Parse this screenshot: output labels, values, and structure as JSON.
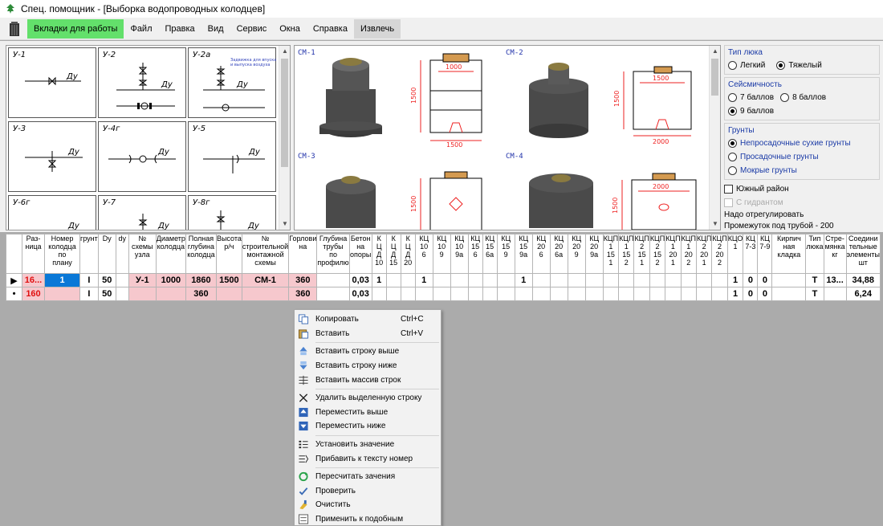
{
  "window": {
    "title": "Спец. помощник - [Выборка водопроводных колодцев]"
  },
  "menu": [
    "Вкладки для работы",
    "Файл",
    "Правка",
    "Вид",
    "Сервис",
    "Окна",
    "Справка",
    "Извлечь"
  ],
  "nodes": [
    {
      "label": "У-1",
      "dy": "Ду"
    },
    {
      "label": "У-2",
      "dy": "Ду"
    },
    {
      "label": "У-2а",
      "dy": "Ду"
    },
    {
      "label": "У-3",
      "dy": "Ду"
    },
    {
      "label": "У-4г",
      "dy": "Ду"
    },
    {
      "label": "У-5",
      "dy": "Ду"
    },
    {
      "label": "У-6г",
      "dy": "Ду"
    },
    {
      "label": "У-7",
      "dy": "Ду"
    },
    {
      "label": "У-8г",
      "dy": "Ду"
    }
  ],
  "schemes": [
    {
      "label": "СМ-1",
      "w": "1000",
      "h": "1500",
      "b": "1500"
    },
    {
      "label": "СМ-2",
      "w": "1500",
      "h": "1500",
      "b": "2000"
    },
    {
      "label": "СМ-3",
      "h": "1500"
    },
    {
      "label": "СМ-4",
      "w": "2000",
      "h": "1500"
    }
  ],
  "options": {
    "hatch_title": "Тип люка",
    "hatch": [
      {
        "label": "Легкий",
        "checked": false
      },
      {
        "label": "Тяжелый",
        "checked": true
      }
    ],
    "seismic_title": "Сейсмичность",
    "seismic": [
      {
        "label": "7 баллов",
        "checked": false
      },
      {
        "label": "8 баллов",
        "checked": false
      },
      {
        "label": "9 баллов",
        "checked": true
      }
    ],
    "soil_title": "Грунты",
    "soil": [
      {
        "label": "Непросадочные сухие грунты",
        "checked": true
      },
      {
        "label": "Просадочные грунты",
        "checked": false
      },
      {
        "label": "Мокрые грунты",
        "checked": false
      }
    ],
    "south": "Южный район",
    "hydrant": "С гидрантом",
    "adjust": "Надо отрегулировать",
    "gap": "Промежуток под трубой -  200"
  },
  "table": {
    "headers": [
      "Раз-\nница",
      "Номер\nколодца\nпо\nплану",
      "грунт",
      "Dy",
      "dy",
      "№\nсхемы\nузла",
      "Диаметр\nколодца",
      "Полная\nглубина\nколодца",
      "Высота\nр/ч",
      "№\nстроительной\nмонтажной\nсхемы",
      "Горлови\nна",
      "Глубина\nтрубы\nпо\nпрофилю",
      "Бетон\nна\nопоры",
      "К\nЦ\nД\n10",
      "К\nЦ\nД\n15",
      "К\nЦ\nД\n20",
      "КЦ\n10\n6",
      "КЦ\n10\n9",
      "КЦ\n10\n9а",
      "КЦ\n15\n6",
      "КЦ\n15\n6а",
      "КЦ\n15\n9",
      "КЦ\n15\n9а",
      "КЦ\n20\n6",
      "КЦ\n20\n6а",
      "КЦ\n20\n9",
      "КЦ\n20\n9а",
      "КЦП\n1\n15\n1",
      "КЦП\n1\n15\n2",
      "КЦП\n2\n15\n1",
      "КЦП\n2\n15\n2",
      "КЦП\n1\n20\n1",
      "КЦП\n1\n20\n2",
      "КЦП\n2\n20\n1",
      "КЦП\n2\n20\n2",
      "КЦО\n1",
      "КЦ\n7-3",
      "КЦ\n7-9",
      "Кирпич\nная\nкладка",
      "Тип\nлюка",
      "Стре-\nмянка\nкг",
      "Соедини\nтельные\nэлементы\nшт"
    ],
    "rows": [
      [
        "16...",
        "1",
        "I",
        "50",
        "",
        "У-1",
        "1000",
        "1860",
        "1500",
        "СМ-1",
        "360",
        "",
        "0,03",
        "1",
        "",
        "",
        "1",
        "",
        "",
        "",
        "",
        "",
        "1",
        "",
        "",
        "",
        "",
        "",
        "",
        "",
        "",
        "",
        "",
        "",
        "",
        "1",
        "0",
        "0",
        "",
        "Т",
        "13...",
        "34,88"
      ],
      [
        "160",
        "",
        "I",
        "50",
        "",
        "",
        "",
        "360",
        "",
        "",
        "360",
        "",
        "0,03",
        "",
        "",
        "",
        "",
        "",
        "",
        "",
        "",
        "",
        "",
        "",
        "",
        "",
        "",
        "",
        "",
        "",
        "",
        "",
        "",
        "",
        "",
        "1",
        "0",
        "0",
        "",
        "Т",
        "",
        "6,24"
      ]
    ]
  },
  "context_menu": [
    {
      "label": "Копировать",
      "shortcut": "Ctrl+C",
      "icon": "copy-icon"
    },
    {
      "label": "Вставить",
      "shortcut": "Ctrl+V",
      "icon": "paste-icon"
    },
    {
      "sep": true
    },
    {
      "label": "Вставить строку выше",
      "icon": "insert-row-above-icon"
    },
    {
      "label": "Вставить строку ниже",
      "icon": "insert-row-below-icon"
    },
    {
      "label": "Вставить массив строк",
      "icon": "insert-rows-array-icon"
    },
    {
      "sep": true
    },
    {
      "label": "Удалить выделенную строку",
      "icon": "delete-icon"
    },
    {
      "label": "Переместить выше",
      "icon": "move-up-icon"
    },
    {
      "label": "Переместить ниже",
      "icon": "move-down-icon"
    },
    {
      "sep": true
    },
    {
      "label": "Установить значение",
      "icon": "set-value-icon"
    },
    {
      "label": "Прибавить к тексту номер",
      "icon": "append-number-icon"
    },
    {
      "sep": true
    },
    {
      "label": "Пересчитать зачения",
      "icon": "recalculate-icon"
    },
    {
      "label": "Проверить",
      "icon": "check-icon"
    },
    {
      "label": "Очистить",
      "icon": "clear-icon"
    },
    {
      "label": "Применить к подобным",
      "icon": "apply-similar-icon"
    }
  ]
}
